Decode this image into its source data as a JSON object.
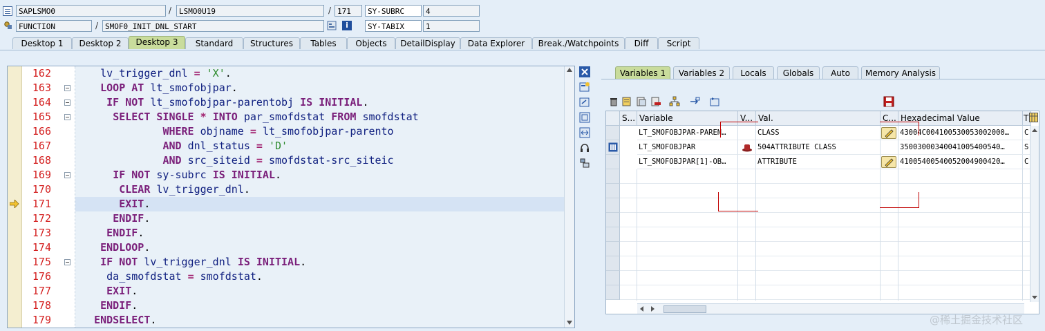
{
  "header": {
    "program": "SAPLSMO0",
    "include": "LSMO0U19",
    "line": "171",
    "var1_name": "SY-SUBRC",
    "var1_value": "4",
    "event_type": "FUNCTION",
    "event_name": "SMOF0_INIT_DNL_START",
    "var2_name": "SY-TABIX",
    "var2_value": "1"
  },
  "main_tabs": [
    "Desktop 1",
    "Desktop 2",
    "Desktop 3",
    "Standard",
    "Structures",
    "Tables",
    "Objects",
    "DetailDisplay",
    "Data Explorer",
    "Break./Watchpoints",
    "Diff",
    "Script"
  ],
  "active_main_tab": "Desktop 3",
  "code": {
    "current_line": "171",
    "lines": [
      {
        "num": "162",
        "text": "lv_trigger_dnl = 'X'."
      },
      {
        "num": "163",
        "text": "LOOP AT lt_smofobjpar."
      },
      {
        "num": "164",
        "text": "IF NOT lt_smofobjpar-parentobj IS INITIAL."
      },
      {
        "num": "165",
        "text": "SELECT SINGLE * INTO par_smofdstat FROM smofdstat"
      },
      {
        "num": "166",
        "text": "WHERE objname = lt_smofobjpar-parento"
      },
      {
        "num": "167",
        "text": "AND dnl_status = 'D'"
      },
      {
        "num": "168",
        "text": "AND src_siteid = smofdstat-src_siteic"
      },
      {
        "num": "169",
        "text": "IF NOT sy-subrc IS INITIAL."
      },
      {
        "num": "170",
        "text": "CLEAR lv_trigger_dnl."
      },
      {
        "num": "171",
        "text": "EXIT."
      },
      {
        "num": "172",
        "text": "ENDIF."
      },
      {
        "num": "173",
        "text": "ENDIF."
      },
      {
        "num": "174",
        "text": "ENDLOOP."
      },
      {
        "num": "175",
        "text": "IF NOT lv_trigger_dnl IS INITIAL."
      },
      {
        "num": "176",
        "text": "da_smofdstat = smofdstat."
      },
      {
        "num": "177",
        "text": "EXIT."
      },
      {
        "num": "178",
        "text": "ENDIF."
      },
      {
        "num": "179",
        "text": "ENDSELECT."
      }
    ]
  },
  "var_tabs": [
    "Variables 1",
    "Variables 2",
    "Locals",
    "Globals",
    "Auto",
    "Memory Analysis"
  ],
  "active_var_tab": "Variables 1",
  "grid": {
    "headers": {
      "s": "S...",
      "variable": "Variable",
      "v": "V...",
      "val": "Val.",
      "c": "C...",
      "hex": "Hexadecimal Value",
      "t": "T"
    },
    "rows": [
      {
        "variable": "LT_SMOFOBJPAR-PAREN…",
        "val": "CLASS",
        "hex": "43004C004100530053002000…",
        "t": "C"
      },
      {
        "variable": "LT_SMOFOBJPAR",
        "val": "504ATTRIBUTE        CLASS",
        "hex": "35003000340041005400540…",
        "t": "S"
      },
      {
        "variable": "LT_SMOFOBJPAR[1]-OB…",
        "val": "ATTRIBUTE",
        "hex": "41005400540052004900420…",
        "t": "C"
      }
    ]
  },
  "watermark": "@稀土掘金技术社区"
}
